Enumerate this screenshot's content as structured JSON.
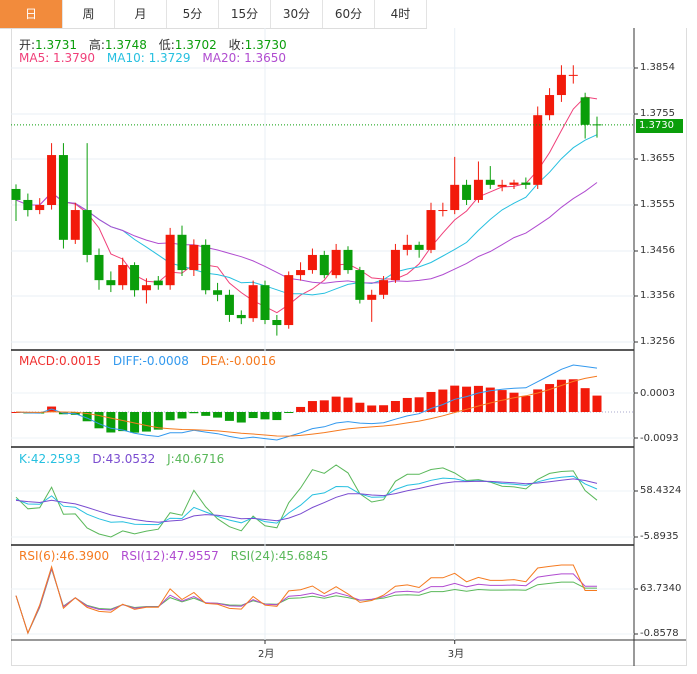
{
  "tabs": [
    "日",
    "周",
    "月",
    "5分",
    "15分",
    "30分",
    "60分",
    "4时"
  ],
  "active_tab": 0,
  "ohlc": {
    "open_label": "开:",
    "open": "1.3731",
    "high_label": "高:",
    "high": "1.3748",
    "low_label": "低:",
    "low": "1.3702",
    "close_label": "收:",
    "close": "1.3730"
  },
  "ma": {
    "ma5": "MA5: 1.3790",
    "ma10": "MA10: 1.3729",
    "ma20": "MA20: 1.3650"
  },
  "macd": {
    "macd": "MACD:0.0015",
    "diff": "DIFF:-0.0008",
    "dea": "DEA:-0.0016"
  },
  "kdj": {
    "k": "K:42.2593",
    "d": "D:43.0532",
    "j": "J:40.6716"
  },
  "rsi": {
    "rsi6": "RSI(6):46.3900",
    "rsi12": "RSI(12):47.9557",
    "rsi24": "RSI(24):45.6845"
  },
  "price_axis": [
    "1.3854",
    "1.3755",
    "1.3655",
    "1.3555",
    "1.3456",
    "1.3356",
    "1.3256"
  ],
  "current_price": "1.3730",
  "macd_axis": [
    "0.0003",
    "-0.0093"
  ],
  "kdj_axis": [
    "58.4324",
    "-5.8935"
  ],
  "rsi_axis": [
    "63.7340",
    "-0.8578"
  ],
  "x_labels": [
    {
      "label": "2月",
      "index": 21
    },
    {
      "label": "3月",
      "index": 37
    }
  ],
  "colors": {
    "up": "#f21a0a",
    "down": "#0a9e0a",
    "ma5": "#f0407a",
    "ma10": "#27c0e0",
    "ma20": "#b04cd0",
    "diff": "#3399ee",
    "dea": "#f57a20",
    "k": "#27c0e0",
    "d": "#7a4cd0",
    "j": "#5ab85a",
    "rsi6": "#f57a20",
    "rsi12": "#b04cd0",
    "rsi24": "#5ab85a",
    "accent": "#f28b3c"
  },
  "candles": [
    [
      1.359,
      1.36,
      1.352,
      1.3566
    ],
    [
      1.3566,
      1.358,
      1.353,
      1.3544
    ],
    [
      1.3544,
      1.357,
      1.3535,
      1.3555
    ],
    [
      1.3555,
      1.369,
      1.3545,
      1.3664
    ],
    [
      1.3664,
      1.369,
      1.346,
      1.3479
    ],
    [
      1.3479,
      1.356,
      1.347,
      1.3544
    ],
    [
      1.3544,
      1.369,
      1.343,
      1.3446
    ],
    [
      1.3446,
      1.346,
      1.337,
      1.3391
    ],
    [
      1.3391,
      1.341,
      1.3365,
      1.338
    ],
    [
      1.338,
      1.344,
      1.337,
      1.3424
    ],
    [
      1.3424,
      1.343,
      1.3355,
      1.3369
    ],
    [
      1.3369,
      1.3395,
      1.334,
      1.338
    ],
    [
      1.339,
      1.34,
      1.337,
      1.338
    ],
    [
      1.338,
      1.3505,
      1.337,
      1.349
    ],
    [
      1.349,
      1.351,
      1.34,
      1.3413
    ],
    [
      1.3413,
      1.348,
      1.34,
      1.3468
    ],
    [
      1.3468,
      1.348,
      1.336,
      1.3369
    ],
    [
      1.3369,
      1.3385,
      1.3345,
      1.3359
    ],
    [
      1.3359,
      1.337,
      1.33,
      1.3315
    ],
    [
      1.3315,
      1.3325,
      1.3295,
      1.3308
    ],
    [
      1.3308,
      1.339,
      1.33,
      1.338
    ],
    [
      1.338,
      1.339,
      1.3295,
      1.3304
    ],
    [
      1.3304,
      1.3315,
      1.327,
      1.3293
    ],
    [
      1.3293,
      1.341,
      1.3285,
      1.3402
    ],
    [
      1.3402,
      1.343,
      1.339,
      1.3413
    ],
    [
      1.3413,
      1.346,
      1.3405,
      1.3446
    ],
    [
      1.3446,
      1.3455,
      1.3395,
      1.3402
    ],
    [
      1.3402,
      1.347,
      1.3395,
      1.3457
    ],
    [
      1.3457,
      1.3465,
      1.3405,
      1.3413
    ],
    [
      1.3413,
      1.342,
      1.334,
      1.3348
    ],
    [
      1.3348,
      1.337,
      1.33,
      1.3359
    ],
    [
      1.3359,
      1.34,
      1.335,
      1.3391
    ],
    [
      1.3391,
      1.347,
      1.3385,
      1.3457
    ],
    [
      1.3457,
      1.349,
      1.3445,
      1.3468
    ],
    [
      1.3468,
      1.3475,
      1.344,
      1.3457
    ],
    [
      1.3457,
      1.356,
      1.345,
      1.3544
    ],
    [
      1.3544,
      1.356,
      1.353,
      1.3544
    ],
    [
      1.3544,
      1.366,
      1.3535,
      1.3599
    ],
    [
      1.3599,
      1.361,
      1.3555,
      1.3566
    ],
    [
      1.3566,
      1.365,
      1.356,
      1.361
    ],
    [
      1.361,
      1.364,
      1.359,
      1.3599
    ],
    [
      1.3595,
      1.361,
      1.3585,
      1.3599
    ],
    [
      1.3599,
      1.361,
      1.359,
      1.3604
    ],
    [
      1.3604,
      1.3615,
      1.359,
      1.3599
    ],
    [
      1.3599,
      1.377,
      1.359,
      1.3751
    ],
    [
      1.3751,
      1.381,
      1.374,
      1.3795
    ],
    [
      1.3795,
      1.386,
      1.378,
      1.3839
    ],
    [
      1.3839,
      1.386,
      1.382,
      1.3839
    ],
    [
      1.379,
      1.38,
      1.37,
      1.373
    ],
    [
      1.3731,
      1.3748,
      1.3702,
      1.373
    ]
  ]
}
